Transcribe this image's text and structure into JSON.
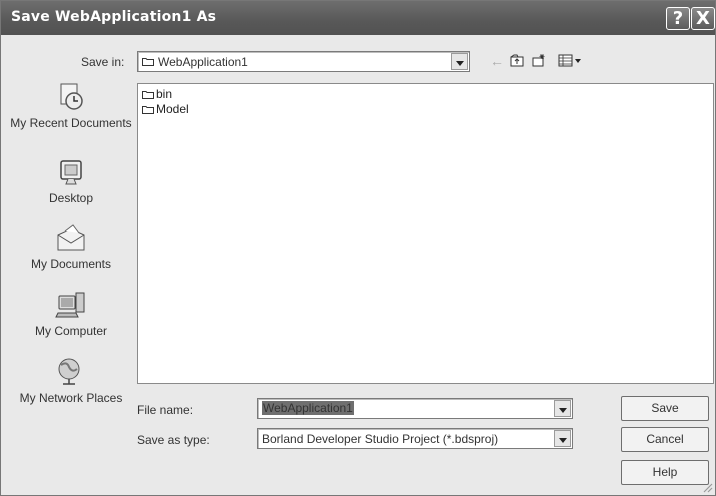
{
  "dialog": {
    "title": "Save WebApplication1 As",
    "help_glyph": "?",
    "close_glyph": "X"
  },
  "toolbar": {
    "save_in_label": "Save in:",
    "save_in_value": "WebApplication1",
    "back_icon": "←",
    "up_icon": "⬑",
    "new_folder_icon": "✱",
    "views_icon": "▦▾"
  },
  "places": [
    {
      "label": "My Recent Documents",
      "icon": "recent-documents-icon"
    },
    {
      "label": "Desktop",
      "icon": "desktop-icon"
    },
    {
      "label": "My Documents",
      "icon": "my-documents-icon"
    },
    {
      "label": "My Computer",
      "icon": "my-computer-icon"
    },
    {
      "label": "My Network Places",
      "icon": "network-places-icon"
    }
  ],
  "files": [
    {
      "name": "bin",
      "type": "folder"
    },
    {
      "name": "Model",
      "type": "folder"
    }
  ],
  "form": {
    "file_name_label": "File name:",
    "file_name_value": "WebApplication1",
    "save_type_label": "Save as type:",
    "save_type_value": "Borland Developer Studio Project (*.bdsproj)"
  },
  "buttons": {
    "save": "Save",
    "cancel": "Cancel",
    "help": "Help"
  }
}
